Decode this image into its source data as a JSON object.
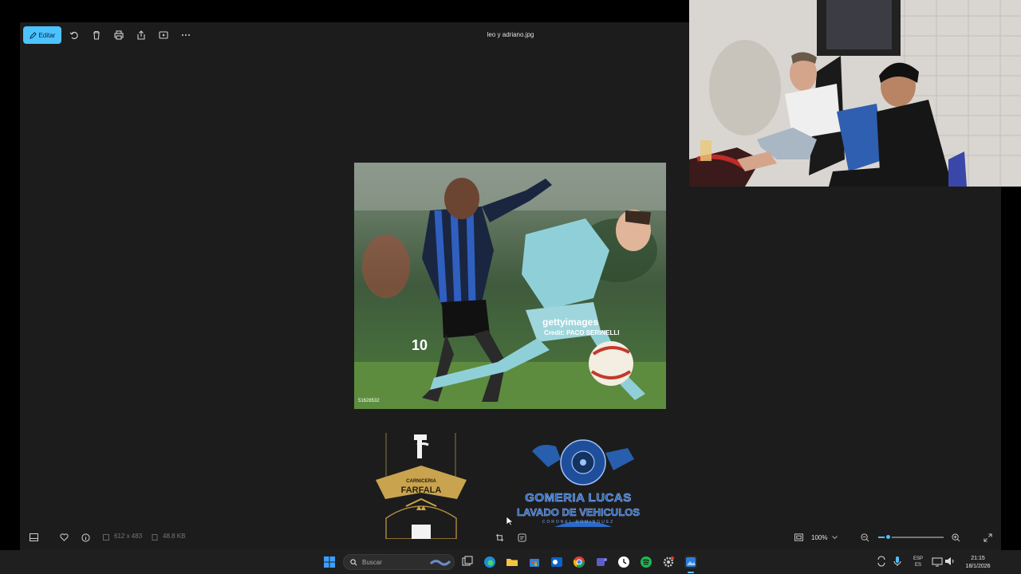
{
  "viewer": {
    "toolbar": {
      "edit_label": "Editar",
      "file_name": "leo y adriano.jpg",
      "buttons": [
        "rotate-icon",
        "delete-icon",
        "print-icon",
        "share-icon",
        "slideshow-icon",
        "more-icon"
      ]
    },
    "photo": {
      "watermark": "gettyimages",
      "credit": "Credit: PACO SERINELLI",
      "image_id": "51628532",
      "jersey_number": "10"
    },
    "logos": {
      "farfala": {
        "top_text": "CARNICERIA",
        "name": "FARFALA"
      },
      "gomeria": {
        "line1": "GOMERIA LUCAS",
        "line2": "LAVADO DE VEHICULOS",
        "line3": "CORONEL DOMINGUEZ"
      }
    },
    "bottombar": {
      "dimensions": "612 x 483",
      "file_size": "48.8 KB",
      "zoom": "100%",
      "zoom_level": 0.15
    }
  },
  "taskbar": {
    "search_placeholder": "Buscar",
    "lang_top": "ESP",
    "lang_bottom": "ES",
    "time": "21:15",
    "date": "18/1/2026"
  },
  "colors": {
    "accent": "#4cc2ff",
    "viewer_bg": "#1c1c1c",
    "taskbar_bg": "#1f1f1f"
  }
}
